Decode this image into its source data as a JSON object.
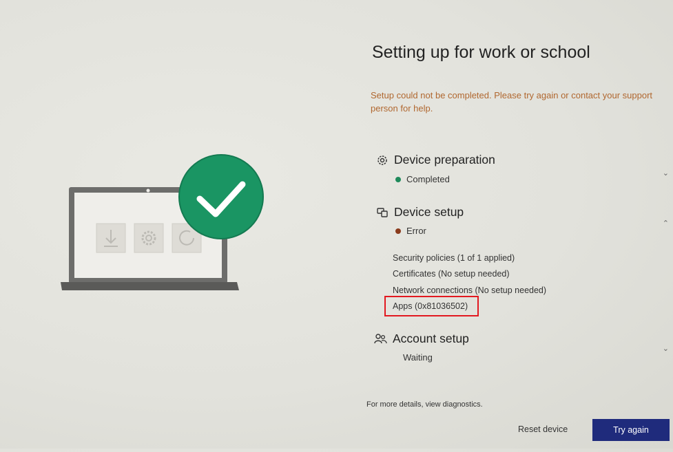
{
  "page": {
    "title": "Setting up for work or school",
    "error_message": "Setup could not be completed. Please try again or contact your support person for help."
  },
  "sections": {
    "device_preparation": {
      "label": "Device preparation",
      "status": "Completed",
      "status_color": "#1f8a5b"
    },
    "device_setup": {
      "label": "Device setup",
      "status": "Error",
      "status_color": "#8a3b1c",
      "details": [
        "Security policies (1 of 1 applied)",
        "Certificates (No setup needed)",
        "Network connections (No setup needed)",
        "Apps (0x81036502)"
      ]
    },
    "account_setup": {
      "label": "Account setup",
      "status": "Waiting"
    }
  },
  "footer": {
    "diagnostics_text": "For more details, view diagnostics.",
    "reset_label": "Reset device",
    "try_again_label": "Try again"
  },
  "icons": {
    "device_preparation": "gear-icon",
    "device_setup": "devices-icon",
    "account_setup": "people-icon",
    "illustration": "laptop-checkmark-illustration"
  },
  "colors": {
    "accent_button": "#1f2b7c",
    "success_badge": "#1a9563",
    "error_text": "#b0672f",
    "highlight_box": "#e2181f"
  }
}
